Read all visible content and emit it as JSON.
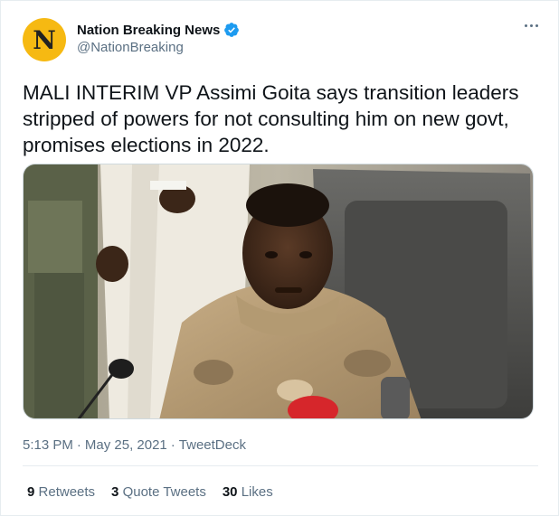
{
  "account": {
    "avatar_letter": "N",
    "display_name": "Nation Breaking News",
    "handle": "@NationBreaking",
    "avatar_color": "#f6b912",
    "verified_color": "#1d9bf0"
  },
  "tweet": {
    "text": "MALI INTERIM VP Assimi Goita says transition leaders stripped of powers for not consulting him on new govt, promises elections in 2022.",
    "time": "5:13 PM",
    "separator": "·",
    "date": "May 25, 2021",
    "source": "TweetDeck"
  },
  "stats": {
    "retweets_count": "9",
    "retweets_label": "Retweets",
    "quotes_count": "3",
    "quotes_label": "Quote Tweets",
    "likes_count": "30",
    "likes_label": "Likes"
  },
  "icons": {
    "more": "more-horizontal-icon",
    "verified": "verified-badge-icon"
  }
}
